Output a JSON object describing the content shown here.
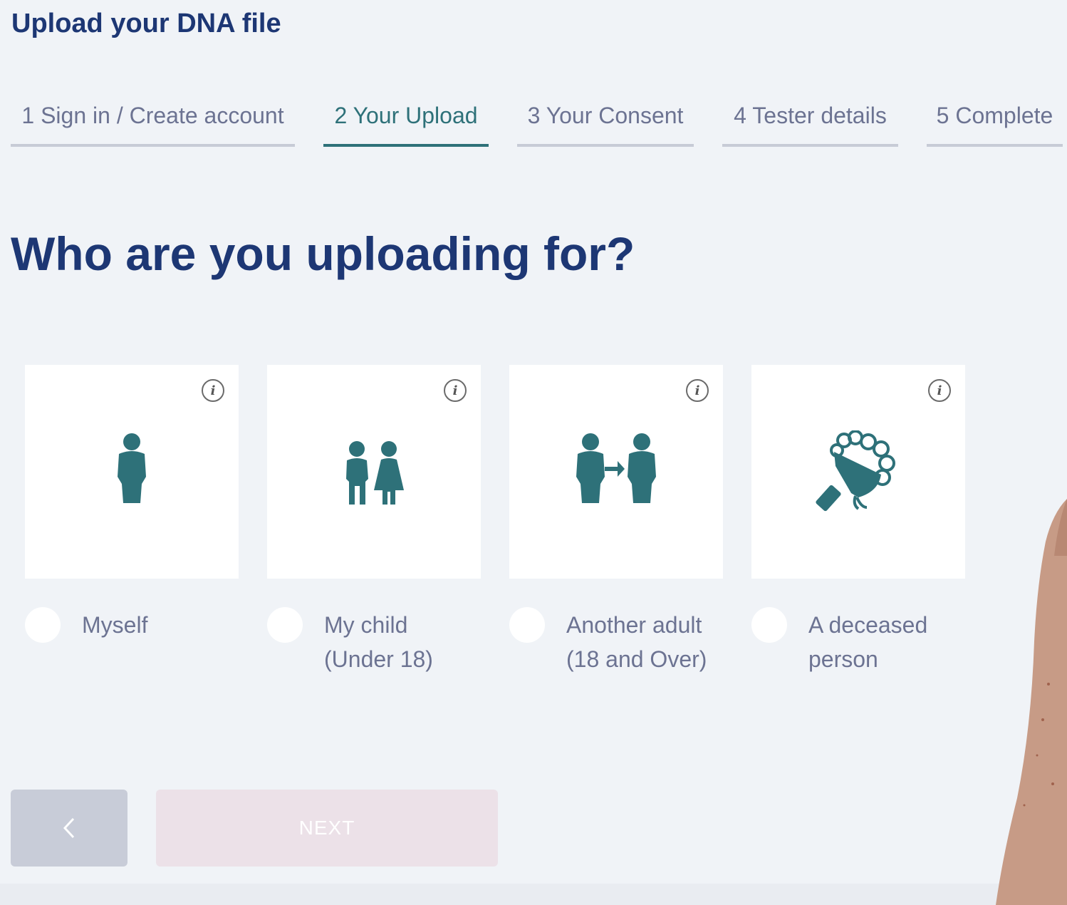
{
  "header": {
    "title": "Upload your DNA file"
  },
  "stepper": {
    "steps": [
      {
        "label": "1 Sign in / Create account",
        "active": false
      },
      {
        "label": "2 Your Upload",
        "active": true
      },
      {
        "label": "3 Your Consent",
        "active": false
      },
      {
        "label": "4 Tester details",
        "active": false
      },
      {
        "label": "5 Complete",
        "active": false
      }
    ]
  },
  "main": {
    "question": "Who are you uploading for?",
    "options": [
      {
        "icon": "single-person-icon",
        "info_icon": "i",
        "label_line1": "Myself",
        "label_line2": "",
        "selected": false
      },
      {
        "icon": "children-icon",
        "info_icon": "i",
        "label_line1": "My child",
        "label_line2": "(Under 18)",
        "selected": false
      },
      {
        "icon": "two-adults-arrow-icon",
        "info_icon": "i",
        "label_line1": "Another adult",
        "label_line2": "(18 and Over)",
        "selected": false
      },
      {
        "icon": "flower-bouquet-icon",
        "info_icon": "i",
        "label_line1": "A deceased",
        "label_line2": "person",
        "selected": false
      }
    ]
  },
  "footer": {
    "back_icon": "chevron-left-icon",
    "next_label": "NEXT",
    "next_enabled": false
  },
  "colors": {
    "background": "#f0f3f7",
    "title": "#1d3774",
    "accent": "#2e7179",
    "muted_text": "#6c7392",
    "next_disabled_bg": "#ece1e8",
    "back_bg": "#c8ccd8"
  }
}
